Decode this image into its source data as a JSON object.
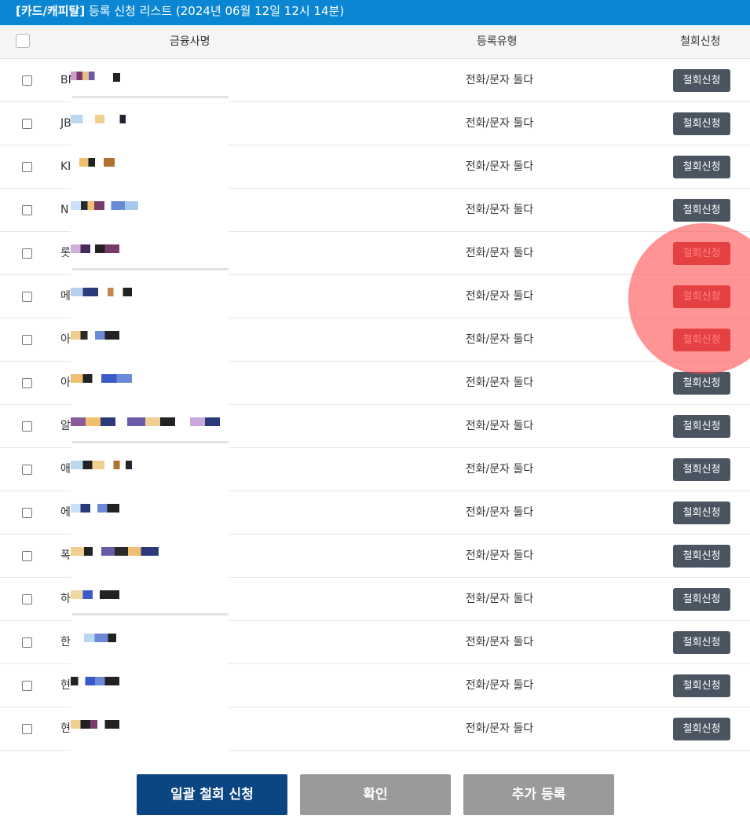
{
  "header": {
    "category": "[카드/캐피탈]",
    "title": "등록 신청 리스트 (2024년 06월 12일 12시 14분)"
  },
  "table": {
    "columns": {
      "company": "금융사명",
      "type": "등록유형",
      "withdraw": "철회신청"
    },
    "rows": [
      {
        "name_prefix": "BN",
        "type": "전화/문자 둘다",
        "button": "철회신청"
      },
      {
        "name_prefix": "JB",
        "type": "전화/문자 둘다",
        "button": "철회신청"
      },
      {
        "name_prefix": "KI",
        "type": "전화/문자 둘다",
        "button": "철회신청"
      },
      {
        "name_prefix": "N",
        "type": "전화/문자 둘다",
        "button": "철회신청"
      },
      {
        "name_prefix": "롯",
        "type": "전화/문자 둘다",
        "button": "철회신청"
      },
      {
        "name_prefix": "메",
        "type": "전화/문자 둘다",
        "button": "철회신청"
      },
      {
        "name_prefix": "아",
        "type": "전화/문자 둘다",
        "button": "철회신청"
      },
      {
        "name_prefix": "아",
        "type": "전화/문자 둘다",
        "button": "철회신청"
      },
      {
        "name_prefix": "알",
        "type": "전화/문자 둘다",
        "button": "철회신청"
      },
      {
        "name_prefix": "애",
        "type": "전화/문자 둘다",
        "button": "철회신청"
      },
      {
        "name_prefix": "에",
        "type": "전화/문자 둘다",
        "button": "철회신청"
      },
      {
        "name_prefix": "폭",
        "type": "전화/문자 둘다",
        "button": "철회신청"
      },
      {
        "name_prefix": "하",
        "type": "전화/문자 둘다",
        "button": "철회신청"
      },
      {
        "name_prefix": "한",
        "type": "전화/문자 둘다",
        "button": "철회신청"
      },
      {
        "name_prefix": "현",
        "type": "전화/문자 둘다",
        "button": "철회신청"
      },
      {
        "name_prefix": "현",
        "type": "전화/문자 둘다",
        "button": "철회신청"
      }
    ]
  },
  "footer": {
    "bulk_withdraw": "일괄 철회 신청",
    "confirm": "확인",
    "add_register": "추가 등록"
  },
  "colors": {
    "header_bg": "#0b86d3",
    "withdraw_button": "#4a5561",
    "primary_button": "#0b4683",
    "secondary_button": "#9a9a9a",
    "highlight": "#ff4646"
  }
}
